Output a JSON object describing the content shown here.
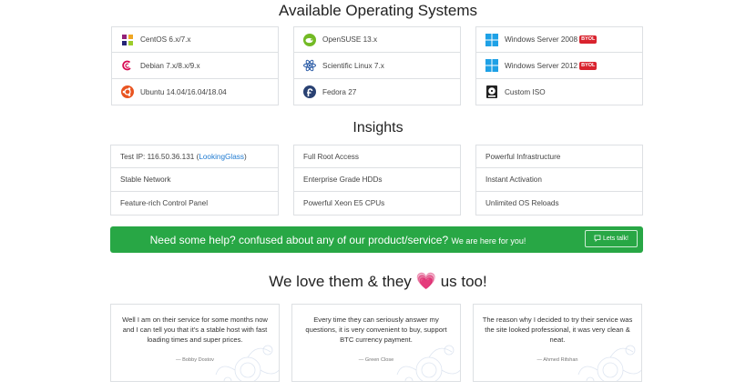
{
  "sections": {
    "os_title": "Available Operating Systems",
    "insights_title": "Insights",
    "love_title_before": "We love them & they",
    "love_title_heart": "💗",
    "love_title_after": "us too!"
  },
  "os": {
    "col1": [
      {
        "label": "CentOS 6.x/7.x",
        "icon": "centos-icon"
      },
      {
        "label": "Debian 7.x/8.x/9.x",
        "icon": "debian-icon"
      },
      {
        "label": "Ubuntu 14.04/16.04/18.04",
        "icon": "ubuntu-icon"
      }
    ],
    "col2": [
      {
        "label": "OpenSUSE 13.x",
        "icon": "opensuse-icon"
      },
      {
        "label": "Scientific Linux 7.x",
        "icon": "scientific-linux-icon"
      },
      {
        "label": "Fedora 27",
        "icon": "fedora-icon"
      }
    ],
    "col3": [
      {
        "label": "Windows Server 2008",
        "badge": "BYOL",
        "icon": "windows-icon"
      },
      {
        "label": "Windows Server 2012",
        "badge": "BYOL",
        "icon": "windows-icon"
      },
      {
        "label": "Custom ISO",
        "icon": "iso-icon"
      }
    ]
  },
  "insights": {
    "test_ip_prefix": "Test IP: 116.50.36.131 (",
    "test_ip_link": "LookingGlass",
    "test_ip_suffix": ")",
    "col1": [
      "Stable Network",
      "Feature-rich Control Panel"
    ],
    "col2": [
      "Full Root Access",
      "Enterprise Grade HDDs",
      "Powerful Xeon E5 CPUs"
    ],
    "col3": [
      "Powerful Infrastructure",
      "Instant Activation",
      "Unlimited OS Reloads"
    ]
  },
  "help": {
    "text_large": "Need some help? confused about any of our product/service?",
    "text_small": "We are here for you!",
    "button_label": "Lets talk!"
  },
  "testimonials": [
    {
      "quote": "Well I am on their service for some months now and I can tell you that it's a stable host with fast loading times and super prices.",
      "author": "— Bobby Dostov"
    },
    {
      "quote": "Every time they can seriously answer my questions, it is very convenient to buy, support BTC currency payment.",
      "author": "— Green Close"
    },
    {
      "quote": "The reason why I decided to try their service was the site looked professional, it was very clean & neat.",
      "author": "— Ahmed Rifshan"
    }
  ],
  "colors": {
    "banner_green": "#28a745",
    "badge_red": "#d9232e",
    "heart_pink": "#e91e8c",
    "link_blue": "#1e7ad1"
  }
}
